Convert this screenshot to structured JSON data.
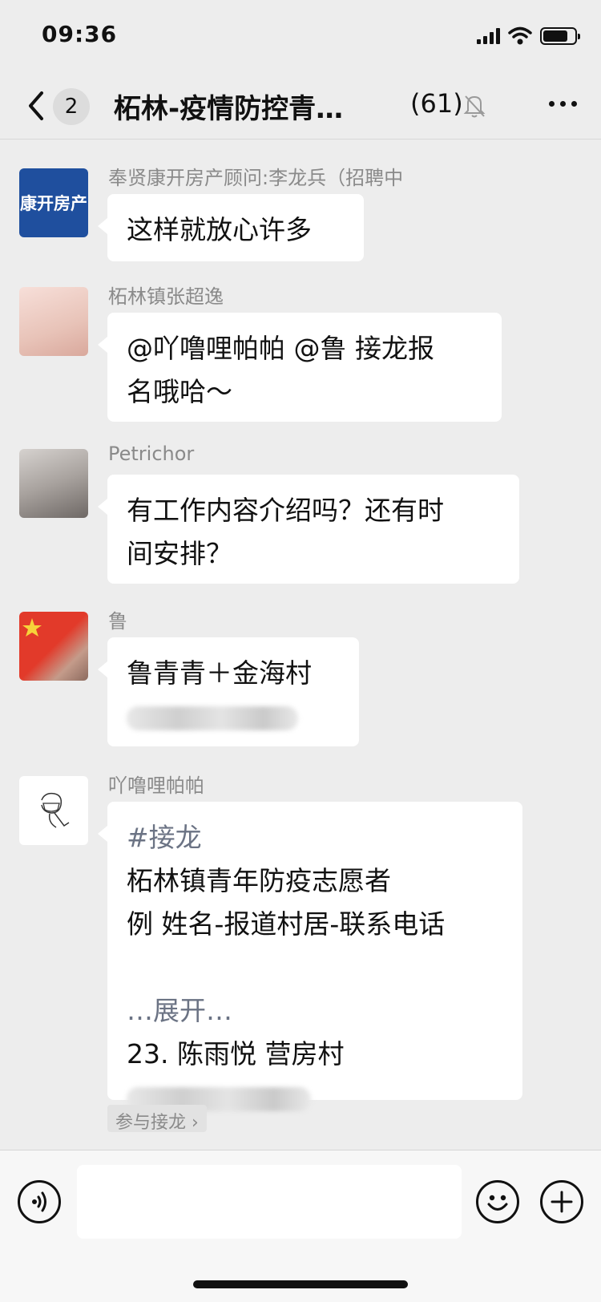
{
  "status_bar": {
    "time": "09:36"
  },
  "header": {
    "unread_count": "2",
    "title": "柘林-疫情防控青…",
    "member_count": "(61)"
  },
  "messages": [
    {
      "sender": "奉贤康开房产顾问:李龙兵（招聘中",
      "avatar_text": "康开房产",
      "lines": [
        "这样就放心许多"
      ]
    },
    {
      "sender": "柘林镇张超逸",
      "lines": [
        "@吖噜哩帕帕 @鲁 接龙报",
        "名哦哈～"
      ]
    },
    {
      "sender": "Petrichor",
      "lines": [
        "有工作内容介绍吗？还有时",
        "间安排？"
      ]
    },
    {
      "sender": "鲁",
      "lines": [
        "鲁青青＋金海村"
      ]
    },
    {
      "sender": "吖噜哩帕帕",
      "lines": [
        "#接龙",
        "柘林镇青年防疫志愿者",
        "例 姓名-报道村居-联系电话",
        "…展开…",
        "23. 陈雨悦 营房村"
      ],
      "join_label": "参与接龙 ›"
    }
  ],
  "input": {
    "value": ""
  },
  "colors": {
    "background": "#ededed",
    "bubble": "#ffffff",
    "brand_avatar": "#1f4f9e"
  }
}
